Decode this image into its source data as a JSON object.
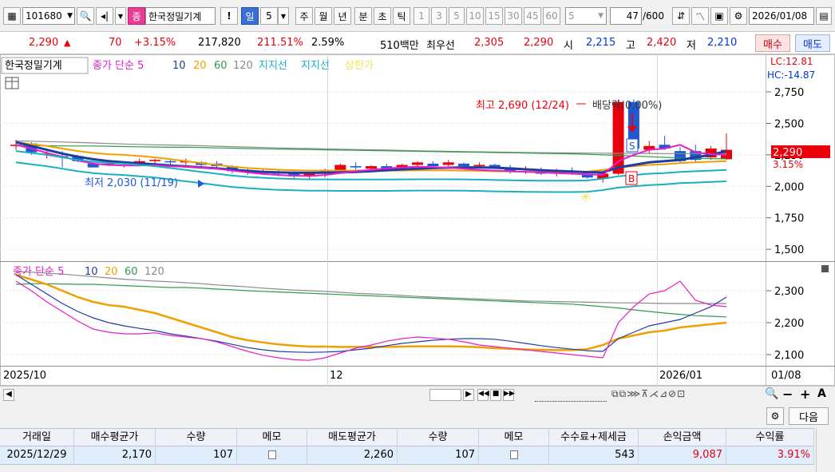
{
  "toolbar": {
    "code": "101680",
    "badge": "종",
    "stock_name": "한국정밀기계",
    "excl": "!",
    "periods": [
      "일",
      "5",
      "주",
      "월",
      "년",
      "분",
      "초",
      "틱"
    ],
    "minutes": [
      "1",
      "3",
      "5",
      "10",
      "15",
      "30",
      "45",
      "60"
    ],
    "count_select": "5",
    "count": "47",
    "count_total": "/600",
    "date": "2026/01/08"
  },
  "info": {
    "price": "2,290",
    "change": "70",
    "change_pct": "+3.15%",
    "volume": "217,820",
    "vol_ratio": "211.51%",
    "turnover": "2.59%",
    "amount": "510백만",
    "priority_label": "최우선",
    "ask": "2,305",
    "bid": "2,290",
    "open_label": "시",
    "open": "2,215",
    "high_label": "고",
    "high": "2,420",
    "low_label": "저",
    "low": "2,210",
    "buy_label": "매수",
    "sell_label": "매도"
  },
  "legend_main": {
    "name": "한국정밀기계",
    "ma_title": "종가 단순 5",
    "ma10": "10",
    "ma20": "20",
    "ma60": "60",
    "ma120": "120",
    "support1": "지지선",
    "support2": "지지선",
    "upper": "상한가"
  },
  "legend_sub": {
    "ma_title": "종가 단순 5",
    "ma10": "10",
    "ma20": "20",
    "ma60": "60",
    "ma120": "120"
  },
  "main_axis": {
    "lc": "LC:12.81",
    "hc": "HC:-14.87",
    "ticks": [
      "2,750",
      "2,500",
      "2,250",
      "2,000",
      "1,750",
      "1,500"
    ],
    "current": "2,290",
    "current_pct": "3.15%"
  },
  "sub_axis": {
    "ticks": [
      "2,300",
      "2,200",
      "2,100"
    ]
  },
  "annotations": {
    "high": "최고 2,690 (12/24)",
    "dividend": "배당락(0.00%)",
    "low": "최저 2,030 (11/19)",
    "sell_mark": "S",
    "buy_mark": "B"
  },
  "x_axis": {
    "labels": [
      "2025/10",
      "12",
      "2026/01",
      "01/08"
    ]
  },
  "actions": {
    "next_label": "다음"
  },
  "table": {
    "headers": [
      "거래일",
      "매수평균가",
      "수량",
      "메모",
      "매도평균가",
      "수량",
      "메모",
      "수수료+제세금",
      "손익금액",
      "수익률"
    ],
    "row": [
      "2025/12/29",
      "2,170",
      "107",
      "",
      "2,260",
      "107",
      "",
      "543",
      "9,087",
      "3.91%"
    ]
  },
  "colors": {
    "up": "#e8000b",
    "down": "#1f5ad6",
    "ma5": "#e61ec8",
    "ma10": "#1f3ca0",
    "ma20": "#f0a000",
    "ma60": "#2e9b4e",
    "ma120": "#8a8a8a",
    "support": "#1ab0c0"
  },
  "chart_data": [
    {
      "type": "candlestick",
      "title": "한국정밀기계",
      "ylim": [
        1450,
        2820
      ],
      "ticks": [
        1500,
        1750,
        2000,
        2250,
        2500,
        2750
      ],
      "candles": [
        {
          "o": 2330,
          "h": 2370,
          "l": 2290,
          "c": 2330
        },
        {
          "o": 2340,
          "h": 2350,
          "l": 2250,
          "c": 2270
        },
        {
          "o": 2260,
          "h": 2280,
          "l": 2220,
          "c": 2260
        },
        {
          "o": 2240,
          "h": 2280,
          "l": 2150,
          "c": 2230
        },
        {
          "o": 2240,
          "h": 2250,
          "l": 2190,
          "c": 2200
        },
        {
          "o": 2180,
          "h": 2200,
          "l": 2150,
          "c": 2150
        },
        {
          "o": 2180,
          "h": 2210,
          "l": 2160,
          "c": 2180
        },
        {
          "o": 2170,
          "h": 2200,
          "l": 2150,
          "c": 2170
        },
        {
          "o": 2180,
          "h": 2220,
          "l": 2170,
          "c": 2200
        },
        {
          "o": 2200,
          "h": 2220,
          "l": 2180,
          "c": 2210
        },
        {
          "o": 2200,
          "h": 2210,
          "l": 2170,
          "c": 2190
        },
        {
          "o": 2190,
          "h": 2220,
          "l": 2170,
          "c": 2200
        },
        {
          "o": 2190,
          "h": 2200,
          "l": 2160,
          "c": 2170
        },
        {
          "o": 2180,
          "h": 2200,
          "l": 2150,
          "c": 2160
        },
        {
          "o": 2160,
          "h": 2170,
          "l": 2100,
          "c": 2120
        },
        {
          "o": 2130,
          "h": 2150,
          "l": 2090,
          "c": 2110
        },
        {
          "o": 2120,
          "h": 2140,
          "l": 2090,
          "c": 2110
        },
        {
          "o": 2110,
          "h": 2130,
          "l": 2080,
          "c": 2100
        },
        {
          "o": 2110,
          "h": 2120,
          "l": 2060,
          "c": 2080
        },
        {
          "o": 2080,
          "h": 2110,
          "l": 2050,
          "c": 2100
        },
        {
          "o": 2100,
          "h": 2140,
          "l": 2070,
          "c": 2130
        },
        {
          "o": 2130,
          "h": 2180,
          "l": 2100,
          "c": 2170
        },
        {
          "o": 2160,
          "h": 2190,
          "l": 2130,
          "c": 2150
        },
        {
          "o": 2140,
          "h": 2170,
          "l": 2120,
          "c": 2160
        },
        {
          "o": 2160,
          "h": 2180,
          "l": 2130,
          "c": 2140
        },
        {
          "o": 2150,
          "h": 2180,
          "l": 2140,
          "c": 2170
        },
        {
          "o": 2170,
          "h": 2200,
          "l": 2150,
          "c": 2190
        },
        {
          "o": 2180,
          "h": 2200,
          "l": 2150,
          "c": 2160
        },
        {
          "o": 2170,
          "h": 2210,
          "l": 2160,
          "c": 2190
        },
        {
          "o": 2180,
          "h": 2190,
          "l": 2150,
          "c": 2160
        },
        {
          "o": 2170,
          "h": 2190,
          "l": 2140,
          "c": 2170
        },
        {
          "o": 2170,
          "h": 2180,
          "l": 2140,
          "c": 2150
        },
        {
          "o": 2150,
          "h": 2170,
          "l": 2100,
          "c": 2120
        },
        {
          "o": 2130,
          "h": 2160,
          "l": 2100,
          "c": 2140
        },
        {
          "o": 2130,
          "h": 2150,
          "l": 2090,
          "c": 2100
        },
        {
          "o": 2100,
          "h": 2140,
          "l": 2080,
          "c": 2130
        },
        {
          "o": 2120,
          "h": 2150,
          "l": 2090,
          "c": 2110
        },
        {
          "o": 2100,
          "h": 2120,
          "l": 2060,
          "c": 2070
        },
        {
          "o": 2060,
          "h": 2120,
          "l": 2030,
          "c": 2100
        },
        {
          "o": 2100,
          "h": 2690,
          "l": 2090,
          "c": 2670
        },
        {
          "o": 2670,
          "h": 2690,
          "l": 2290,
          "c": 2300
        },
        {
          "o": 2290,
          "h": 2360,
          "l": 2260,
          "c": 2320
        },
        {
          "o": 2330,
          "h": 2400,
          "l": 2290,
          "c": 2300
        },
        {
          "o": 2280,
          "h": 2310,
          "l": 2180,
          "c": 2200
        },
        {
          "o": 2280,
          "h": 2330,
          "l": 2190,
          "c": 2210
        },
        {
          "o": 2230,
          "h": 2320,
          "l": 2210,
          "c": 2300
        },
        {
          "o": 2215,
          "h": 2420,
          "l": 2210,
          "c": 2290
        }
      ]
    },
    {
      "type": "line",
      "title": "종가 단순 5",
      "ylim": [
        2070,
        2370
      ],
      "ticks": [
        2100,
        2200,
        2300
      ],
      "series": [
        {
          "name": "5",
          "values": [
            2330,
            2300,
            2265,
            2235,
            2205,
            2180,
            2170,
            2165,
            2165,
            2168,
            2160,
            2155,
            2150,
            2140,
            2125,
            2110,
            2098,
            2090,
            2084,
            2082,
            2090,
            2105,
            2120,
            2130,
            2142,
            2150,
            2155,
            2152,
            2148,
            2140,
            2130,
            2125,
            2120,
            2115,
            2110,
            2105,
            2100,
            2095,
            2090,
            2200,
            2250,
            2290,
            2300,
            2330,
            2270,
            2255,
            2250
          ]
        },
        {
          "name": "10",
          "values": [
            2350,
            2320,
            2290,
            2260,
            2235,
            2215,
            2200,
            2190,
            2182,
            2175,
            2165,
            2158,
            2150,
            2142,
            2132,
            2122,
            2115,
            2110,
            2108,
            2107,
            2108,
            2110,
            2115,
            2120,
            2128,
            2135,
            2140,
            2145,
            2148,
            2150,
            2150,
            2148,
            2142,
            2135,
            2128,
            2122,
            2117,
            2112,
            2110,
            2150,
            2170,
            2190,
            2200,
            2210,
            2230,
            2250,
            2280
          ]
        },
        {
          "name": "20",
          "values": [
            2350,
            2335,
            2320,
            2300,
            2280,
            2265,
            2255,
            2250,
            2240,
            2230,
            2215,
            2200,
            2185,
            2170,
            2155,
            2145,
            2138,
            2132,
            2128,
            2125,
            2125,
            2124,
            2124,
            2124,
            2124,
            2125,
            2126,
            2126,
            2126,
            2125,
            2123,
            2120,
            2118,
            2116,
            2115,
            2114,
            2114,
            2117,
            2130,
            2150,
            2160,
            2170,
            2175,
            2185,
            2190,
            2195,
            2200
          ]
        },
        {
          "name": "60",
          "values": [
            2320,
            2322,
            2322,
            2321,
            2320,
            2320,
            2318,
            2316,
            2314,
            2312,
            2310,
            2310,
            2308,
            2305,
            2303,
            2300,
            2298,
            2296,
            2294,
            2292,
            2290,
            2288,
            2286,
            2284,
            2282,
            2280,
            2278,
            2276,
            2274,
            2272,
            2270,
            2268,
            2266,
            2264,
            2262,
            2260,
            2258,
            2254,
            2250,
            2246,
            2240,
            2235,
            2230,
            2226,
            2222,
            2220,
            2218
          ]
        },
        {
          "name": "120",
          "values": [
            2360,
            2358,
            2355,
            2352,
            2348,
            2344,
            2340,
            2336,
            2333,
            2330,
            2328,
            2325,
            2322,
            2318,
            2315,
            2312,
            2308,
            2305,
            2302,
            2300,
            2298,
            2295,
            2292,
            2290,
            2288,
            2285,
            2282,
            2280,
            2278,
            2276,
            2274,
            2272,
            2270,
            2268,
            2267,
            2266,
            2265,
            2264,
            2263,
            2262,
            2262,
            2261,
            2260,
            2260,
            2260,
            2260,
            2260
          ]
        }
      ]
    }
  ]
}
